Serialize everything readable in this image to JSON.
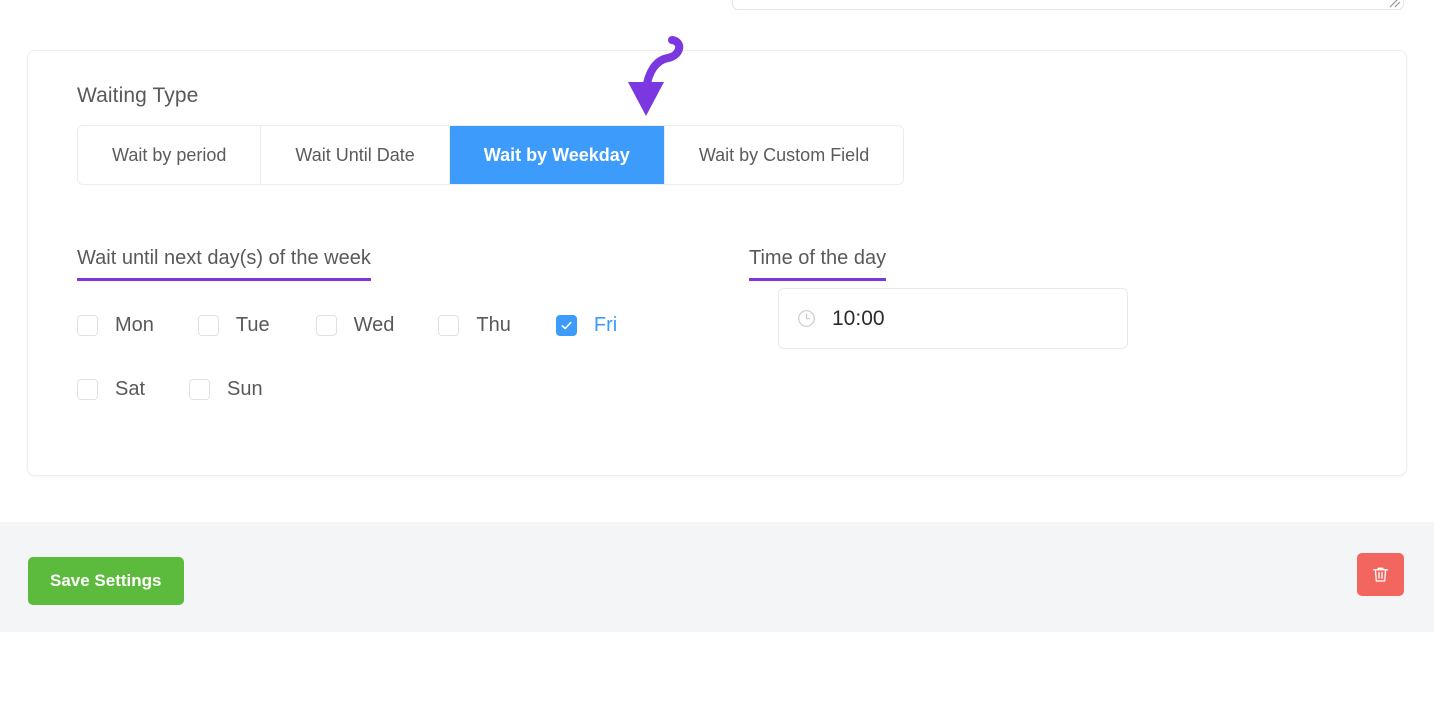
{
  "card": {
    "section_title": "Waiting Type",
    "tabs": [
      {
        "label": "Wait by period",
        "active": false
      },
      {
        "label": "Wait Until Date",
        "active": false
      },
      {
        "label": "Wait by Weekday",
        "active": true
      },
      {
        "label": "Wait by Custom Field",
        "active": false
      }
    ],
    "days_field": {
      "label": "Wait until next day(s) of the week",
      "options": [
        {
          "label": "Mon",
          "checked": false
        },
        {
          "label": "Tue",
          "checked": false
        },
        {
          "label": "Wed",
          "checked": false
        },
        {
          "label": "Thu",
          "checked": false
        },
        {
          "label": "Fri",
          "checked": true
        },
        {
          "label": "Sat",
          "checked": false
        },
        {
          "label": "Sun",
          "checked": false
        }
      ]
    },
    "time_field": {
      "label": "Time of the day",
      "value": "10:00",
      "placeholder": "10:00",
      "icon": "clock-icon"
    }
  },
  "footer": {
    "save_label": "Save Settings",
    "delete_icon": "trash-icon"
  },
  "annotation": {
    "arrow_icon": "curved-down-arrow-icon",
    "color": "#7b38e0"
  },
  "colors": {
    "accent_blue": "#3d9bfb",
    "underline_purple": "#7b38e0",
    "save_green": "#5cba3d",
    "delete_red": "#f2665f",
    "footer_gray": "#f4f5f6",
    "text_gray": "#58595b",
    "border_gray": "#eaecee"
  }
}
